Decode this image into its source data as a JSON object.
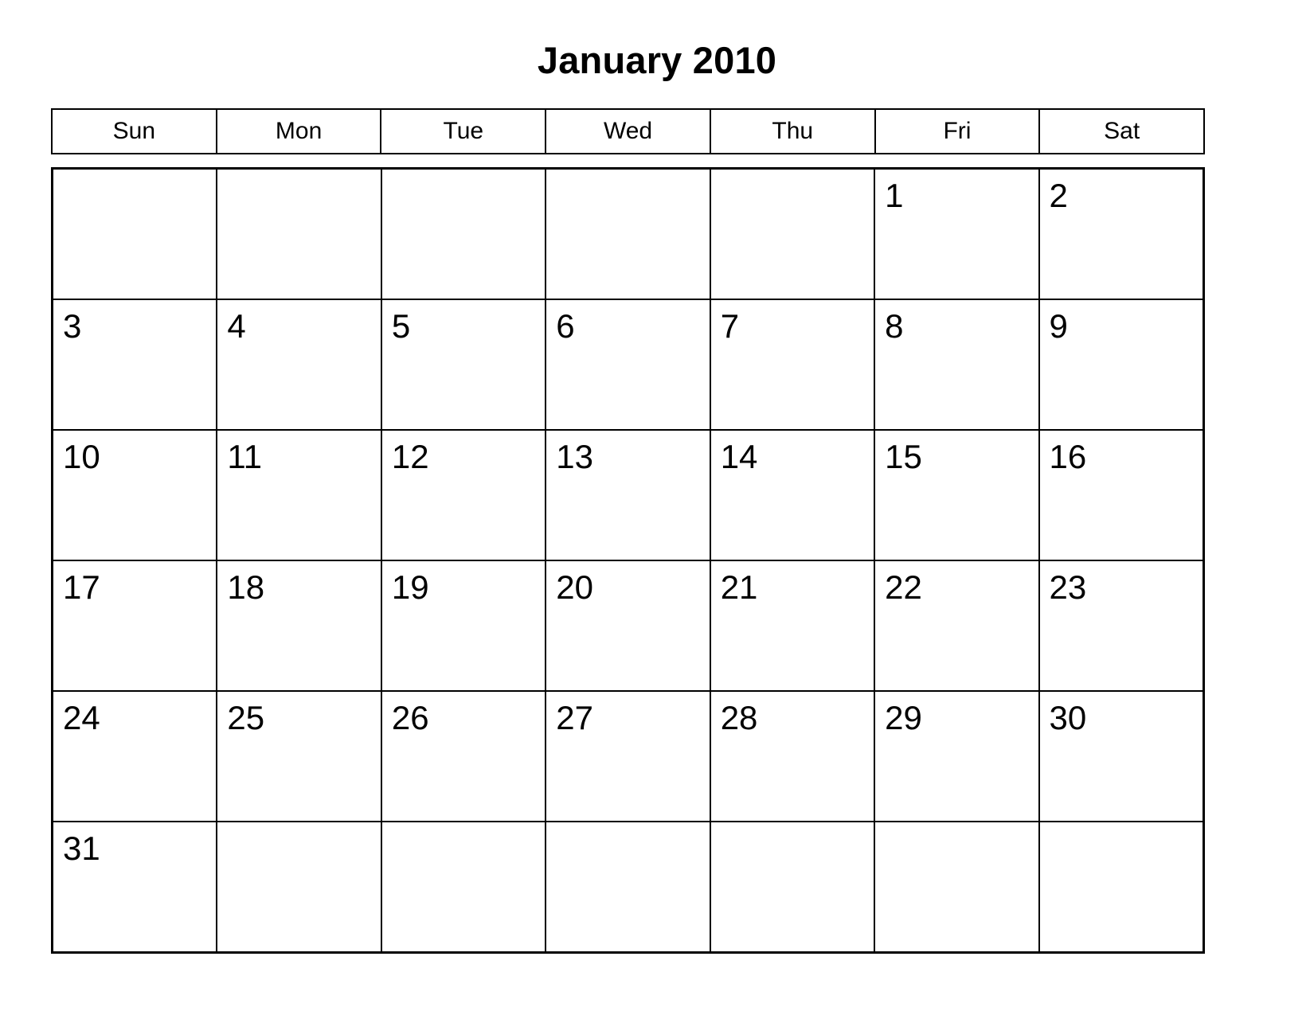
{
  "calendar": {
    "title": "January 2010",
    "month": "January",
    "year": "2010",
    "weekday_headers": [
      {
        "label": "Sun"
      },
      {
        "label": "Mon"
      },
      {
        "label": "Tue"
      },
      {
        "label": "Wed"
      },
      {
        "label": "Thu"
      },
      {
        "label": "Fri"
      },
      {
        "label": "Sat"
      }
    ],
    "weeks": [
      [
        {
          "day": ""
        },
        {
          "day": ""
        },
        {
          "day": ""
        },
        {
          "day": ""
        },
        {
          "day": ""
        },
        {
          "day": "1"
        },
        {
          "day": "2"
        }
      ],
      [
        {
          "day": "3"
        },
        {
          "day": "4"
        },
        {
          "day": "5"
        },
        {
          "day": "6"
        },
        {
          "day": "7"
        },
        {
          "day": "8"
        },
        {
          "day": "9"
        }
      ],
      [
        {
          "day": "10"
        },
        {
          "day": "11"
        },
        {
          "day": "12"
        },
        {
          "day": "13"
        },
        {
          "day": "14"
        },
        {
          "day": "15"
        },
        {
          "day": "16"
        }
      ],
      [
        {
          "day": "17"
        },
        {
          "day": "18"
        },
        {
          "day": "19"
        },
        {
          "day": "20"
        },
        {
          "day": "21"
        },
        {
          "day": "22"
        },
        {
          "day": "23"
        }
      ],
      [
        {
          "day": "24"
        },
        {
          "day": "25"
        },
        {
          "day": "26"
        },
        {
          "day": "27"
        },
        {
          "day": "28"
        },
        {
          "day": "29"
        },
        {
          "day": "30"
        }
      ],
      [
        {
          "day": "31"
        },
        {
          "day": ""
        },
        {
          "day": ""
        },
        {
          "day": ""
        },
        {
          "day": ""
        },
        {
          "day": ""
        },
        {
          "day": ""
        }
      ]
    ],
    "colors": {
      "background": "#ffffff",
      "text": "#000000",
      "grid_line": "#000000"
    }
  }
}
